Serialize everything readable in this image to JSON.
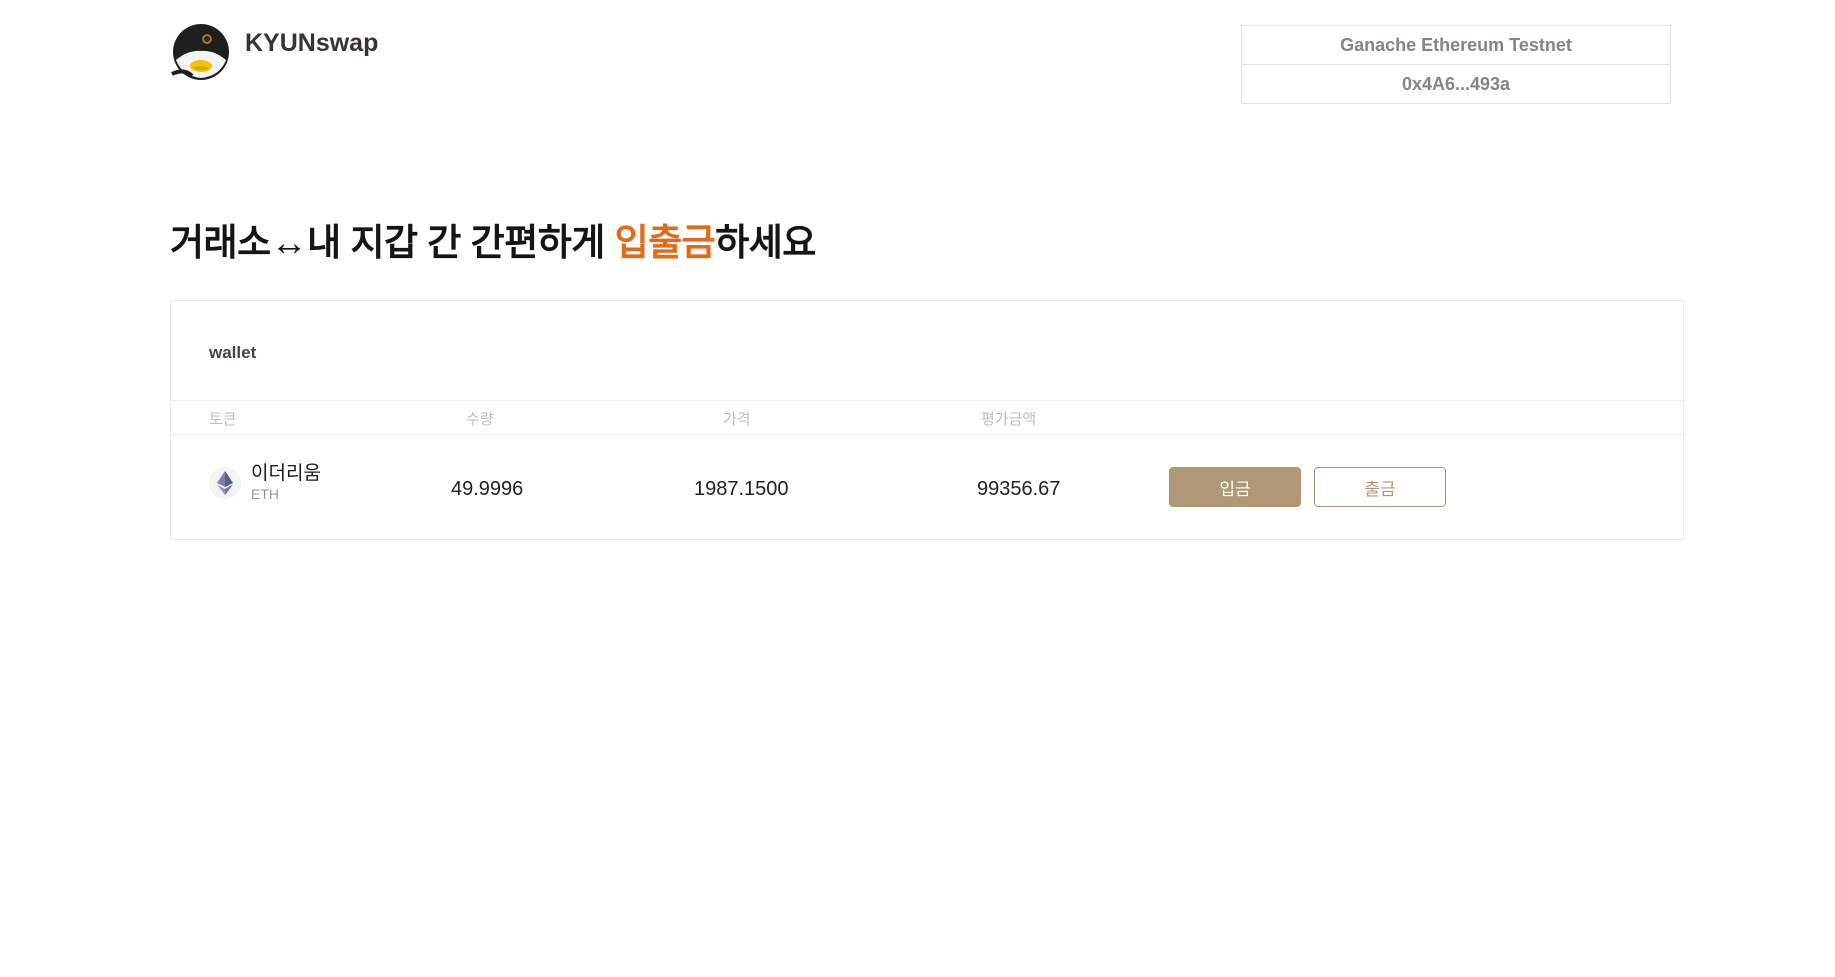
{
  "header": {
    "brand": "KYUNswap",
    "network": "Ganache Ethereum Testnet",
    "account": "0x4A6...493a"
  },
  "hero": {
    "prefix": "거래소↔내 지갑 간 간편하게 ",
    "accent": "입출금",
    "suffix": "하세요",
    "accent_color": "#e36a16"
  },
  "wallet": {
    "title": "wallet",
    "columns": {
      "token": "토큰",
      "amount": "수량",
      "price": "가격",
      "value": "평가금액"
    },
    "rows": [
      {
        "token_name": "이더리움",
        "token_symbol": "ETH",
        "icon": "ethereum-icon",
        "amount": "49.9996",
        "price": "1987.1500",
        "value": "99356.67",
        "deposit_label": "입금",
        "withdraw_label": "출금"
      }
    ]
  },
  "colors": {
    "button": "#b09776"
  }
}
